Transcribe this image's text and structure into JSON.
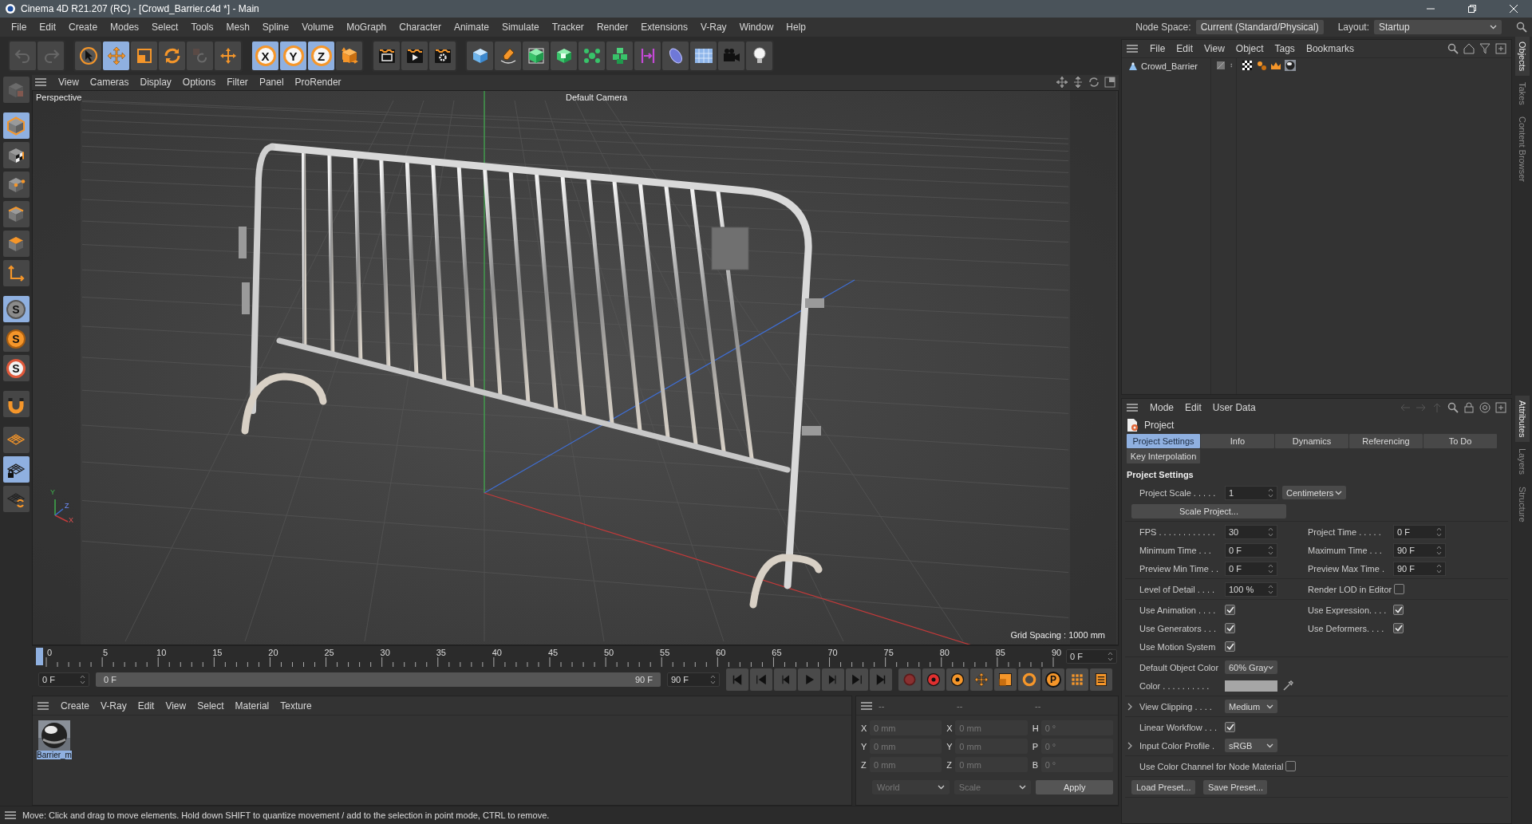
{
  "window": {
    "title": "Cinema 4D R21.207 (RC) - [Crowd_Barrier.c4d *] - Main"
  },
  "menu": [
    "File",
    "Edit",
    "Create",
    "Modes",
    "Select",
    "Tools",
    "Mesh",
    "Spline",
    "Volume",
    "MoGraph",
    "Character",
    "Animate",
    "Simulate",
    "Tracker",
    "Render",
    "Extensions",
    "V-Ray",
    "Window",
    "Help"
  ],
  "node_space": {
    "label": "Node Space:",
    "value": "Current (Standard/Physical)"
  },
  "layout": {
    "label": "Layout:",
    "value": "Startup"
  },
  "toolbar": [
    {
      "tools": [
        {
          "kind": "undo",
          "selected": false
        },
        {
          "kind": "redo",
          "selected": false
        }
      ]
    },
    {
      "tools": [
        {
          "kind": "select",
          "selected": false
        },
        {
          "kind": "move",
          "selected": true
        },
        {
          "kind": "scale",
          "selected": false
        },
        {
          "kind": "rotate",
          "selected": false
        },
        {
          "kind": "psr",
          "selected": false
        },
        {
          "kind": "add",
          "selected": false
        }
      ]
    },
    {
      "tools": [
        {
          "kind": "axis",
          "label": "X",
          "selected": true
        },
        {
          "kind": "axis",
          "label": "Y",
          "selected": true
        },
        {
          "kind": "axis",
          "label": "Z",
          "selected": true
        },
        {
          "kind": "coord",
          "selected": false
        }
      ]
    },
    {
      "tools": [
        {
          "kind": "render-view",
          "selected": false
        },
        {
          "kind": "render",
          "selected": false
        },
        {
          "kind": "render-settings",
          "selected": false
        }
      ]
    },
    {
      "tools": [
        {
          "kind": "cube",
          "selected": false
        },
        {
          "kind": "pen",
          "selected": false
        },
        {
          "kind": "subdiv",
          "selected": false
        },
        {
          "kind": "extrude",
          "selected": false
        },
        {
          "kind": "cloner",
          "selected": false
        },
        {
          "kind": "array",
          "selected": false
        },
        {
          "kind": "symmetry",
          "selected": false
        },
        {
          "kind": "deformer",
          "selected": false
        },
        {
          "kind": "floor",
          "selected": false
        },
        {
          "kind": "camera",
          "selected": false
        },
        {
          "kind": "light",
          "selected": false
        }
      ]
    }
  ],
  "left_tools": [
    {
      "kind": "psr-model",
      "selected": false
    },
    {
      "kind": "model",
      "selected": true
    },
    {
      "kind": "texture",
      "selected": false
    },
    {
      "kind": "points",
      "selected": false
    },
    {
      "kind": "edges",
      "selected": false
    },
    {
      "kind": "polygons",
      "selected": false
    },
    {
      "kind": "axes",
      "selected": false
    },
    {
      "kind": "snap",
      "label": "S",
      "selected": true
    },
    {
      "kind": "snap-settings",
      "label": "S",
      "selected": false
    },
    {
      "kind": "snap-target",
      "label": "S",
      "selected": false
    },
    {
      "kind": "magnet",
      "selected": false
    },
    {
      "kind": "workplane",
      "selected": false
    },
    {
      "kind": "workplane-lock",
      "selected": true
    },
    {
      "kind": "workplane-sync",
      "selected": false
    }
  ],
  "viewport": {
    "menu": [
      "View",
      "Cameras",
      "Display",
      "Options",
      "Filter",
      "Panel",
      "ProRender"
    ],
    "label": "Perspective",
    "camera": "Default Camera",
    "grid_spacing": "Grid Spacing : 1000 mm",
    "gizmo": [
      "Y",
      "Z",
      "X"
    ]
  },
  "timeline": {
    "ticks": [
      "0",
      "5",
      "10",
      "15",
      "20",
      "25",
      "30",
      "35",
      "40",
      "45",
      "50",
      "55",
      "60",
      "65",
      "70",
      "75",
      "80",
      "85",
      "90"
    ],
    "current_field": "0 F",
    "start": "0 F",
    "range": {
      "start": "0 F",
      "end": "90 F",
      "level": 1
    },
    "end": "90 F",
    "playback": [
      {
        "kind": "first"
      },
      {
        "kind": "prev-key"
      },
      {
        "kind": "prev"
      },
      {
        "kind": "play"
      },
      {
        "kind": "next"
      },
      {
        "kind": "next-key"
      },
      {
        "kind": "last"
      }
    ],
    "keys": [
      {
        "kind": "record"
      },
      {
        "kind": "autokey"
      },
      {
        "kind": "key-sel"
      },
      {
        "kind": "key-move"
      },
      {
        "kind": "key-scale"
      },
      {
        "kind": "key-rotate"
      },
      {
        "kind": "key-param",
        "label": "P"
      },
      {
        "kind": "key-grid"
      },
      {
        "kind": "timeline"
      }
    ]
  },
  "materials": {
    "menu": [
      "Create",
      "V-Ray",
      "Edit",
      "View",
      "Select",
      "Material",
      "Texture"
    ],
    "items": [
      {
        "name": "Barrier_m",
        "selected": true
      }
    ]
  },
  "coordinates": {
    "headers": [
      "--",
      "--",
      "--"
    ],
    "rows": [
      [
        {
          "axis": "X",
          "value": "0 mm"
        },
        {
          "axis": "X",
          "value": "0 mm"
        },
        {
          "axis": "H",
          "value": "0 °"
        }
      ],
      [
        {
          "axis": "Y",
          "value": "0 mm"
        },
        {
          "axis": "Y",
          "value": "0 mm"
        },
        {
          "axis": "P",
          "value": "0 °"
        }
      ],
      [
        {
          "axis": "Z",
          "value": "0 mm"
        },
        {
          "axis": "Z",
          "value": "0 mm"
        },
        {
          "axis": "B",
          "value": "0 °"
        }
      ]
    ],
    "mode": "World",
    "type": "Scale",
    "apply": "Apply",
    "disabled": true
  },
  "status": "Move: Click and drag to move elements. Hold down SHIFT to quantize movement / add to the selection in point mode, CTRL to remove.",
  "objects": {
    "menu": [
      "File",
      "Edit",
      "View",
      "Object",
      "Tags",
      "Bookmarks"
    ],
    "items": [
      {
        "name": "Crowd_Barrier",
        "selected": false
      }
    ]
  },
  "attributes": {
    "menu": [
      "Mode",
      "Edit",
      "User Data"
    ],
    "title": "Project",
    "tabs": [
      {
        "label": "Project Settings",
        "selected": true
      },
      {
        "label": "Info",
        "selected": false
      },
      {
        "label": "Dynamics",
        "selected": false
      },
      {
        "label": "Referencing",
        "selected": false
      },
      {
        "label": "To Do",
        "selected": false
      },
      {
        "label": "Key Interpolation",
        "selected": false
      }
    ],
    "heading": "Project Settings",
    "groups": [
      {
        "rows": [
          [
            {
              "kind": "number",
              "label": "Project Scale . . . . .",
              "value": "1"
            },
            {
              "kind": "select",
              "value": "Centimeters"
            }
          ],
          [
            {
              "kind": "button",
              "value": "Scale Project..."
            }
          ]
        ]
      },
      {
        "rows": [
          [
            {
              "kind": "number",
              "label": "FPS . . . . . . . . . . . .",
              "value": "30"
            },
            {
              "kind": "number",
              "label": "Project Time . . . . .",
              "value": "0 F"
            }
          ],
          [
            {
              "kind": "number",
              "label": "Minimum Time . . .",
              "value": "0 F"
            },
            {
              "kind": "number",
              "label": "Maximum Time . . .",
              "value": "90 F"
            }
          ],
          [
            {
              "kind": "number",
              "label": "Preview Min Time . .",
              "value": "0 F"
            },
            {
              "kind": "number",
              "label": "Preview Max Time .",
              "value": "90 F"
            }
          ]
        ]
      },
      {
        "rows": [
          [
            {
              "kind": "number",
              "label": "Level of Detail . . . .",
              "value": "100 %"
            },
            {
              "kind": "check",
              "label": "Render LOD in Editor",
              "checked": false
            }
          ]
        ]
      },
      {
        "rows": [
          [
            {
              "kind": "check",
              "label": "Use Animation . . . .",
              "checked": true
            },
            {
              "kind": "check",
              "label": "Use Expression. . . .",
              "checked": true
            }
          ],
          [
            {
              "kind": "check",
              "label": "Use Generators . . .",
              "checked": true
            },
            {
              "kind": "check",
              "label": "Use Deformers. . . .",
              "checked": true
            }
          ],
          [
            {
              "kind": "check",
              "label": "Use Motion System",
              "checked": true
            }
          ]
        ]
      },
      {
        "rows": [
          [
            {
              "kind": "select",
              "label": "Default Object Color",
              "value": "60% Gray"
            }
          ],
          [
            {
              "kind": "color",
              "label": "Color . . . . . . . . . ."
            }
          ]
        ]
      },
      {
        "rows": [
          [
            {
              "kind": "select",
              "label": "View Clipping . . . .",
              "value": "Medium",
              "expanded": false
            }
          ]
        ]
      },
      {
        "rows": [
          [
            {
              "kind": "check",
              "label": "Linear Workflow . . .",
              "checked": true
            }
          ],
          [
            {
              "kind": "select",
              "label": "Input Color Profile .",
              "value": "sRGB",
              "expanded": false
            }
          ]
        ]
      },
      {
        "rows": [
          [
            {
              "kind": "check",
              "label": "Use Color Channel for Node Material",
              "checked": false
            }
          ]
        ]
      },
      {
        "rows": [
          [
            {
              "kind": "button",
              "value": "Load Preset..."
            },
            {
              "kind": "button",
              "value": "Save Preset..."
            }
          ]
        ]
      }
    ]
  },
  "side_tabs_top": [
    {
      "label": "Objects",
      "selected": true
    },
    {
      "label": "Takes",
      "selected": false
    },
    {
      "label": "Content Browser",
      "selected": false
    }
  ],
  "side_tabs_bottom": [
    {
      "label": "Attributes",
      "selected": true
    },
    {
      "label": "Layers",
      "selected": false
    },
    {
      "label": "Structure",
      "selected": false
    }
  ]
}
